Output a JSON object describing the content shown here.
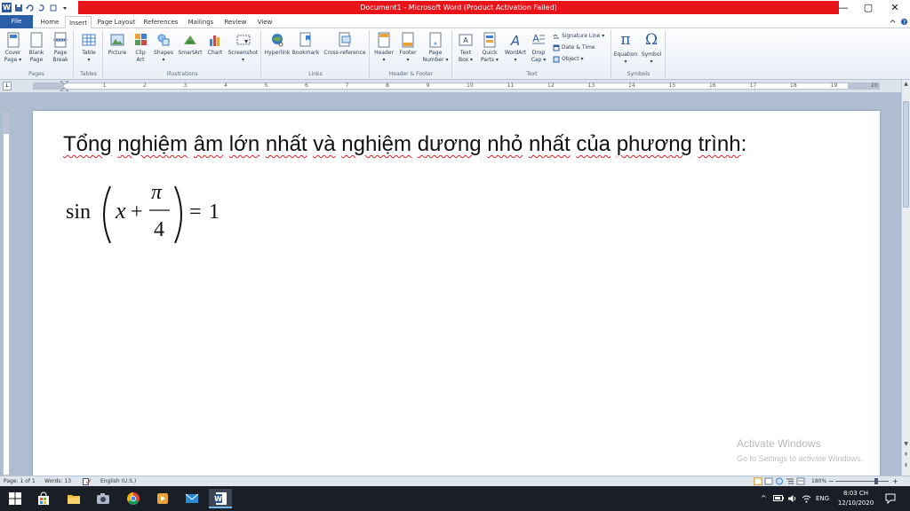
{
  "window": {
    "title": "Document1  -  Microsoft Word (Product Activation Failed)",
    "app_icon": "W",
    "minimize_glyph": "—",
    "maximize_glyph": "▢",
    "close_glyph": "✕"
  },
  "tabs": [
    "File",
    "Home",
    "Insert",
    "Page Layout",
    "References",
    "Mailings",
    "Review",
    "View"
  ],
  "active_tab": "Insert",
  "ribbon": {
    "groups": {
      "pages": "Pages",
      "tables": "Tables",
      "illustrations": "Illustrations",
      "links": "Links",
      "header_footer": "Header & Footer",
      "text": "Text",
      "symbols": "Symbols"
    },
    "buttons": {
      "cover_page": [
        "Cover",
        "Page ▾"
      ],
      "blank_page": [
        "Blank",
        "Page"
      ],
      "page_break": [
        "Page",
        "Break"
      ],
      "table": [
        "Table",
        "▾"
      ],
      "picture": [
        "Picture",
        ""
      ],
      "clip_art": [
        "Clip",
        "Art"
      ],
      "shapes": [
        "Shapes",
        "▾"
      ],
      "smartart": [
        "SmartArt",
        ""
      ],
      "chart": [
        "Chart",
        ""
      ],
      "screenshot": [
        "Screenshot",
        "▾"
      ],
      "hyperlink": [
        "Hyperlink",
        ""
      ],
      "bookmark": [
        "Bookmark",
        ""
      ],
      "cross_reference": [
        "Cross-reference",
        ""
      ],
      "header": [
        "Header",
        "▾"
      ],
      "footer": [
        "Footer",
        "▾"
      ],
      "page_number": [
        "Page",
        "Number ▾"
      ],
      "text_box": [
        "Text",
        "Box ▾"
      ],
      "quick_parts": [
        "Quick",
        "Parts ▾"
      ],
      "wordart": [
        "WordArt",
        "▾"
      ],
      "drop_cap": [
        "Drop",
        "Cap ▾"
      ],
      "signature_line": "Signature Line ▾",
      "date_time": "Date & Time",
      "object": "Object ▾",
      "equation": [
        "Equation",
        "▾"
      ],
      "symbol": [
        "Symbol",
        "▾"
      ]
    },
    "symbol_glyphs": {
      "equation": "π",
      "symbol": "Ω"
    }
  },
  "ruler": {
    "tab_selector": "L",
    "numbers": [
      "1",
      "2",
      "3",
      "4",
      "5",
      "6",
      "7",
      "8",
      "9",
      "10",
      "11",
      "12",
      "13",
      "14",
      "15",
      "16",
      "17",
      "18",
      "19",
      "20"
    ]
  },
  "document": {
    "sentence_words": [
      "Tổng",
      "nghiệm",
      "âm",
      "lớn",
      "nhất",
      "và",
      "nghiệm",
      "dương",
      "nhỏ",
      "nhất",
      "của",
      "phương",
      "trình",
      ":"
    ],
    "equation": {
      "fn": "sin",
      "var": "x",
      "plus": "+",
      "numerator": "π",
      "denominator": "4",
      "equals": "=",
      "rhs": "1"
    },
    "watermark_title": "Activate Windows",
    "watermark_sub": "Go to Settings to activate Windows."
  },
  "status_bar": {
    "page": "Page: 1 of 1",
    "words": "Words: 13",
    "language": "English (U.S.)",
    "zoom": "180%",
    "zoom_minus": "−",
    "zoom_plus": "+"
  },
  "taskbar": {
    "language": "ENG",
    "time": "8:03 CH",
    "date": "12/10/2020",
    "tray_up": "^"
  },
  "colors": {
    "title_red": "#e8141a",
    "file_tab": "#2a5fa8",
    "taskbar": "#1a1e26",
    "doc_bg": "#aebdd0"
  }
}
